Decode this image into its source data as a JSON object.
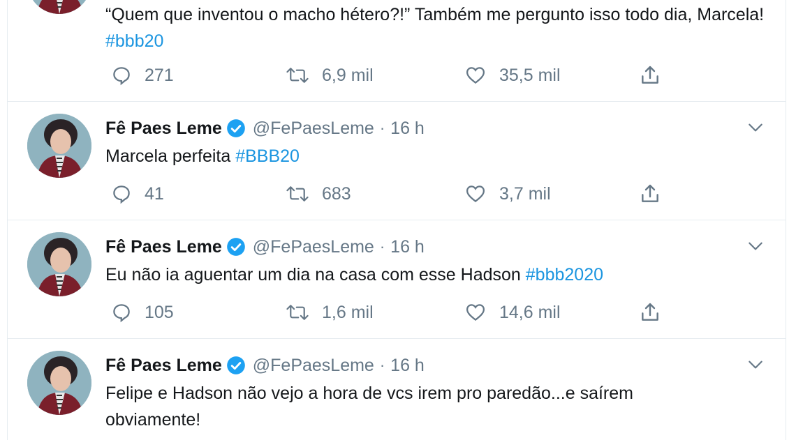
{
  "colors": {
    "text": "#14171a",
    "secondary": "#657786",
    "link": "#1b95e0",
    "verified": "#1da1f2",
    "border": "#e6ecf0"
  },
  "tweets": [
    {
      "text": "“Quem que inventou o macho hétero?!” Também me pergunto isso todo dia, Marcela! ",
      "hashtag": "#bbb20",
      "replies": "271",
      "retweets": "6,9 mil",
      "likes": "35,5 mil"
    },
    {
      "name": "Fê Paes Leme",
      "handle": "@FePaesLeme",
      "separator": "·",
      "time": "16 h",
      "text": "Marcela perfeita ",
      "hashtag": "#BBB20",
      "replies": "41",
      "retweets": "683",
      "likes": "3,7 mil"
    },
    {
      "name": "Fê Paes Leme",
      "handle": "@FePaesLeme",
      "separator": "·",
      "time": "16 h",
      "text": "Eu não ia aguentar um dia na casa com esse Hadson ",
      "hashtag": "#bbb2020",
      "replies": "105",
      "retweets": "1,6 mil",
      "likes": "14,6 mil"
    },
    {
      "name": "Fê Paes Leme",
      "handle": "@FePaesLeme",
      "separator": "·",
      "time": "16 h",
      "text_line1": "Felipe e Hadson não vejo a hora de vcs irem pro paredão...e saírem",
      "text_line2": "obviamente!"
    }
  ],
  "icons": {
    "reply": "reply-icon",
    "retweet": "retweet-icon",
    "like": "like-icon",
    "share": "share-icon",
    "verified": "verified-badge-icon",
    "caret": "chevron-down-icon"
  }
}
